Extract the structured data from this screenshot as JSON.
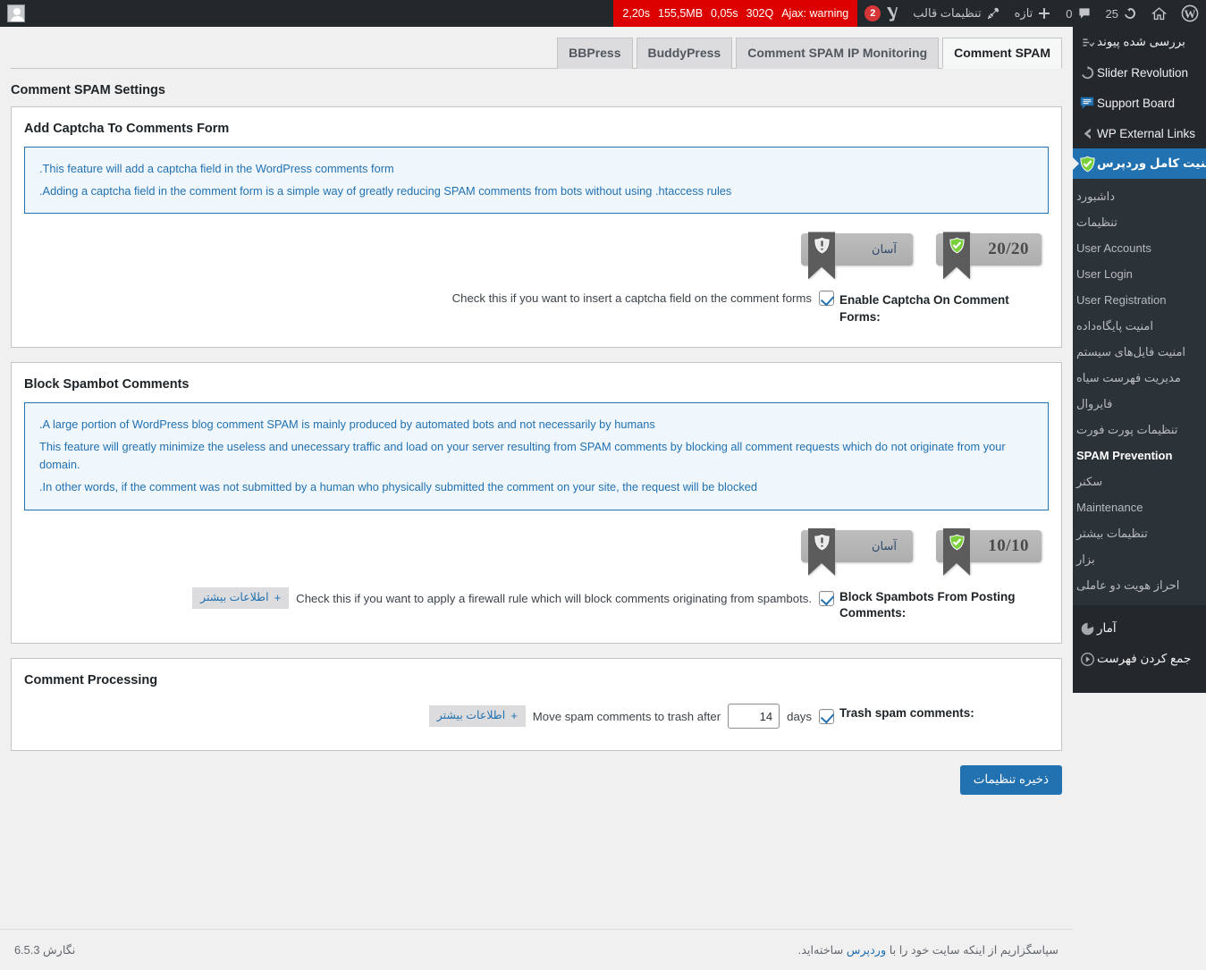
{
  "adminbar": {
    "avatar_name": "avatar",
    "debug": {
      "time": "2,20s",
      "memory": "155,5MB",
      "query_time": "0,05s",
      "queries": "302Q",
      "ajax": "Ajax: warning"
    },
    "items": [
      {
        "name": "yoast-seo",
        "badge": "2",
        "label": ""
      },
      {
        "name": "theme-settings",
        "label": "تنظیمات قالب"
      },
      {
        "name": "new-content",
        "label": "تازه"
      },
      {
        "name": "comments",
        "label": "0"
      },
      {
        "name": "updates",
        "label": "25"
      },
      {
        "name": "site-home",
        "label": ""
      },
      {
        "name": "wp-logo",
        "label": ""
      }
    ]
  },
  "sidebar": {
    "top_items": [
      {
        "label": "بررسی شده پیوند",
        "icon": "link-check-icon",
        "current": false
      },
      {
        "label": "Slider Revolution",
        "icon": "slider-revolution-icon",
        "current": false
      },
      {
        "label": "Support Board",
        "icon": "support-board-icon",
        "current": false
      },
      {
        "label": "WP External Links",
        "icon": "external-link-icon",
        "current": false
      },
      {
        "label": "امنیت کامل وردپرس",
        "icon": "shield-check-icon",
        "current": true
      }
    ],
    "submenu": [
      {
        "label": "داشبورد",
        "current": false
      },
      {
        "label": "تنظیمات",
        "current": false
      },
      {
        "label": "User Accounts",
        "current": false
      },
      {
        "label": "User Login",
        "current": false
      },
      {
        "label": "User Registration",
        "current": false
      },
      {
        "label": "امنیت پایگاه‌داده",
        "current": false
      },
      {
        "label": "امنیت فایل‌های سیستم",
        "current": false
      },
      {
        "label": "مدیریت فهرست سیاه",
        "current": false
      },
      {
        "label": "فایروال",
        "current": false
      },
      {
        "label": "تنظیمات پورت فورت",
        "current": false
      },
      {
        "label": "SPAM Prevention",
        "current": true
      },
      {
        "label": "سکنر",
        "current": false
      },
      {
        "label": "Maintenance",
        "current": false
      },
      {
        "label": "تنظیمات بیشتر",
        "current": false
      },
      {
        "label": "بزار",
        "current": false
      },
      {
        "label": "احراز هویت دو عاملی",
        "current": false
      }
    ],
    "bottom_items": [
      {
        "label": "آمار",
        "icon": "chart-icon",
        "current": false
      },
      {
        "label": "جمع کردن فهرست",
        "icon": "collapse-icon",
        "current": false
      }
    ]
  },
  "tabs": [
    {
      "label": "Comment SPAM",
      "active": true
    },
    {
      "label": "Comment SPAM IP Monitoring",
      "active": false
    },
    {
      "label": "BuddyPress",
      "active": false
    },
    {
      "label": "BBPress",
      "active": false
    }
  ],
  "page": {
    "title": "Comment SPAM Settings"
  },
  "sections": [
    {
      "heading": "Add Captcha To Comments Form",
      "info": [
        ".This feature will add a captcha field in the WordPress comments form",
        ".Adding a captcha field in the comment form is a simple way of greatly reducing SPAM comments from bots without using .htaccess rules"
      ],
      "badges": [
        {
          "name": "score-badge",
          "icon": "shield-check-icon",
          "text": "20/20",
          "fa": false
        },
        {
          "name": "difficulty-badge",
          "icon": "shield-exclamation-icon",
          "text": "آسان",
          "fa": true
        }
      ],
      "rows": [
        {
          "label": "Enable Captcha On Comment Forms:",
          "checked": true,
          "description": "Check this if you want to insert a captcha field on the comment forms",
          "more_info": null,
          "input": null,
          "unit": null
        }
      ]
    },
    {
      "heading": "Block Spambot Comments",
      "info": [
        ".A large portion of WordPress blog comment SPAM is mainly produced by automated bots and not necessarily by humans",
        "This feature will greatly minimize the useless and unecessary traffic and load on your server resulting from SPAM comments by blocking all comment requests which do not originate from your domain.",
        ".In other words, if the comment was not submitted by a human who physically submitted the comment on your site, the request will be blocked"
      ],
      "badges": [
        {
          "name": "score-badge",
          "icon": "shield-check-icon",
          "text": "10/10",
          "fa": false
        },
        {
          "name": "difficulty-badge",
          "icon": "shield-exclamation-icon",
          "text": "آسان",
          "fa": true
        }
      ],
      "rows": [
        {
          "label": "Block Spambots From Posting Comments:",
          "checked": true,
          "description": "Check this if you want to apply a firewall rule which will block comments originating from spambots.",
          "more_info": "اطلاعات بیشتر",
          "more_info_plus": "+",
          "input": null,
          "unit": null
        }
      ]
    },
    {
      "heading": "Comment Processing",
      "info": [],
      "badges": [],
      "rows": [
        {
          "label": "Trash spam comments:",
          "checked": true,
          "description": "Move spam comments to trash after",
          "more_info": "اطلاعات بیشتر",
          "more_info_plus": "+",
          "input": "14",
          "unit": "days"
        }
      ]
    }
  ],
  "save": {
    "label": "ذخیره تنظیمات"
  },
  "footer": {
    "thanks_prefix": "سپاسگزاریم از اینکه سایت خود را با ",
    "wp_link": "وردپرس",
    "thanks_suffix": " ساخته‌اید.",
    "version": "نگارش 6.5.3"
  },
  "colors": {
    "accent": "#2271b1",
    "adminbar_bg": "#23282d",
    "debug_bg": "#dd0000",
    "info_bg": "#f0f7fc",
    "badge_red": "#d63638"
  }
}
